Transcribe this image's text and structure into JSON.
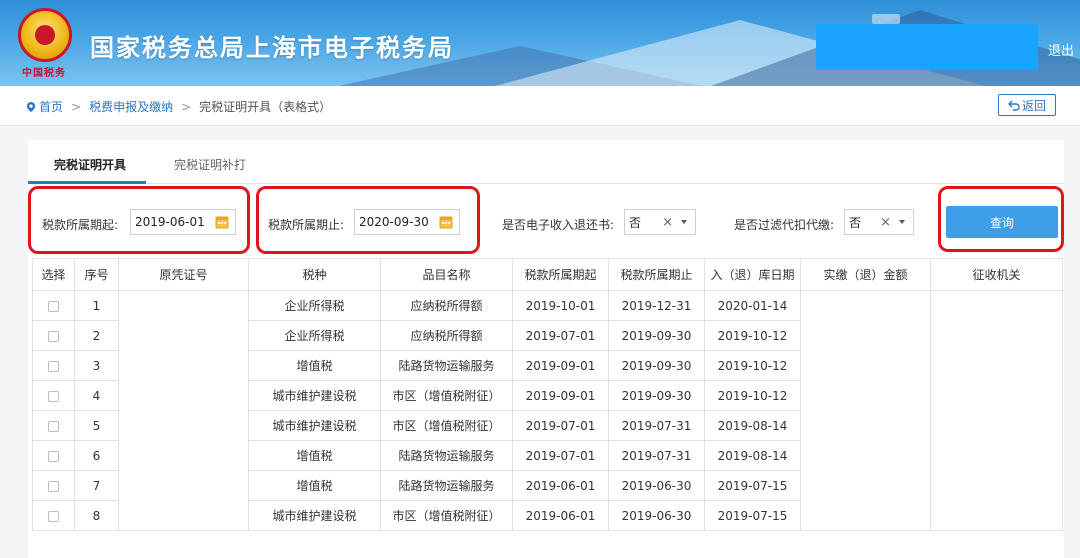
{
  "header": {
    "site_title": "国家税务总局上海市电子税务局",
    "emblem_text": "中国税务",
    "logout_label": "退出"
  },
  "breadcrumb": {
    "home": "首页",
    "section": "税费申报及缴纳",
    "current": "完税证明开具（表格式）",
    "back_label": "返回"
  },
  "tabs": [
    {
      "label": "完税证明开具",
      "active": true
    },
    {
      "label": "完税证明补打",
      "active": false
    }
  ],
  "filters": {
    "period_start_label": "税款所属期起:",
    "period_start_value": "2019-06-01",
    "period_end_label": "税款所属期止:",
    "period_end_value": "2020-09-30",
    "refund_label": "是否电子收入退还书:",
    "refund_value": "否",
    "withhold_label": "是否过滤代扣代缴:",
    "withhold_value": "否",
    "query_label": "查询"
  },
  "table": {
    "columns": [
      "选择",
      "序号",
      "原凭证号",
      "税种",
      "品目名称",
      "税款所属期起",
      "税款所属期止",
      "入（退）库日期",
      "实缴（退）金额",
      "征收机关"
    ],
    "rows": [
      {
        "seq": "1",
        "tax": "企业所得税",
        "item": "应纳税所得额",
        "start": "2019-10-01",
        "end": "2019-12-31",
        "date": "2020-01-14"
      },
      {
        "seq": "2",
        "tax": "企业所得税",
        "item": "应纳税所得额",
        "start": "2019-07-01",
        "end": "2019-09-30",
        "date": "2019-10-12"
      },
      {
        "seq": "3",
        "tax": "增值税",
        "item": "陆路货物运输服务",
        "start": "2019-09-01",
        "end": "2019-09-30",
        "date": "2019-10-12"
      },
      {
        "seq": "4",
        "tax": "城市维护建设税",
        "item": "市区（增值税附征）",
        "start": "2019-09-01",
        "end": "2019-09-30",
        "date": "2019-10-12"
      },
      {
        "seq": "5",
        "tax": "城市维护建设税",
        "item": "市区（增值税附征）",
        "start": "2019-07-01",
        "end": "2019-07-31",
        "date": "2019-08-14"
      },
      {
        "seq": "6",
        "tax": "增值税",
        "item": "陆路货物运输服务",
        "start": "2019-07-01",
        "end": "2019-07-31",
        "date": "2019-08-14"
      },
      {
        "seq": "7",
        "tax": "增值税",
        "item": "陆路货物运输服务",
        "start": "2019-06-01",
        "end": "2019-06-30",
        "date": "2019-07-15"
      },
      {
        "seq": "8",
        "tax": "城市维护建设税",
        "item": "市区（增值税附征）",
        "start": "2019-06-01",
        "end": "2019-06-30",
        "date": "2019-07-15"
      }
    ]
  },
  "colors": {
    "accent": "#2b78c8",
    "query_button": "#3e9ee8",
    "highlight": "#e0141f"
  }
}
